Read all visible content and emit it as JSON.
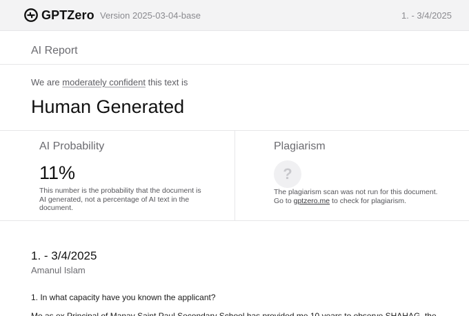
{
  "header": {
    "brand_name": "GPTZero",
    "version": "Version 2025-03-04-base",
    "doc_ref": "1. - 3/4/2025",
    "brand_icon": "gptzero-logo-icon"
  },
  "report": {
    "title": "AI Report"
  },
  "verdict": {
    "prefix": "We are ",
    "confidence": "moderately confident",
    "suffix": " this text is",
    "label": "Human Generated"
  },
  "ai_probability": {
    "title": "AI Probability",
    "value": "11%",
    "note": "This number is the probability that the document is AI generated, not a percentage of AI text in the document."
  },
  "plagiarism": {
    "title": "Plagiarism",
    "icon": "question-mark-icon",
    "note_prefix": "The plagiarism scan was not run for this document. Go to ",
    "link": "gptzero.me",
    "note_suffix": " to check for plagiarism."
  },
  "document": {
    "heading": "1. - 3/4/2025",
    "author": "Amanul Islam",
    "question": "1. In what capacity have you known the applicant?",
    "answer_preview": "Me as ex Principal of Manav Saint Paul Secondary School has provided me 10 years to observe SHAHAG, the"
  },
  "colors": {
    "header_bg": "#f3f3f4",
    "divider": "#e6e6e8",
    "muted_text": "#6b6b70"
  }
}
